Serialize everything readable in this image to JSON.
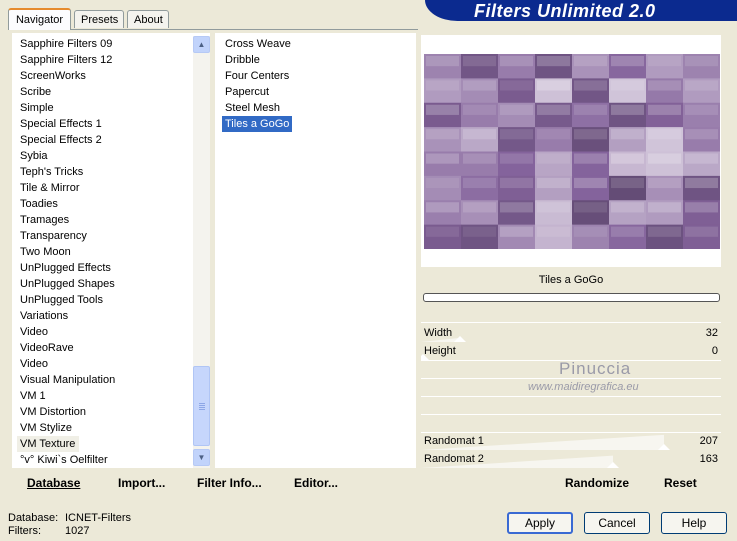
{
  "tabs": [
    {
      "label": "Navigator"
    },
    {
      "label": "Presets"
    },
    {
      "label": "About"
    }
  ],
  "title": "Filters Unlimited 2.0",
  "categories": [
    "Sapphire Filters 09",
    "Sapphire Filters 12",
    "ScreenWorks",
    "Scribe",
    "Simple",
    "Special Effects 1",
    "Special Effects 2",
    "Sybia",
    "Teph's Tricks",
    "Tile & Mirror",
    "Toadies",
    "Tramages",
    "Transparency",
    "Two Moon",
    "UnPlugged Effects",
    "UnPlugged Shapes",
    "UnPlugged Tools",
    "Variations",
    "Video",
    "VideoRave",
    "Video",
    "Visual Manipulation",
    "VM 1",
    "VM Distortion",
    "VM Stylize",
    "VM Texture",
    "°v° Kiwi`s Oelfilter"
  ],
  "filters": [
    "Cross Weave",
    "Dribble",
    "Four Centers",
    "Papercut",
    "Steel Mesh",
    "Tiles a GoGo"
  ],
  "selected_filter": "Tiles a GoGo",
  "highlighted_category": "VM Texture",
  "bottom_buttons": {
    "database": "Database",
    "import": "Import...",
    "filter_info": "Filter Info...",
    "editor": "Editor..."
  },
  "preview": {
    "filter_name": "Tiles a GoGo",
    "base_color": "#7a5a8c"
  },
  "params": [
    {
      "label": "Width",
      "value": "32",
      "level": 0.13
    },
    {
      "label": "Height",
      "value": "0",
      "level": 0.0
    },
    {
      "label": "Randomat 1",
      "value": "207",
      "level": 0.81
    },
    {
      "label": "Randomat 2",
      "value": "163",
      "level": 0.64
    }
  ],
  "watermark": {
    "line1": "Pinuccia",
    "line2": "www.maidiregrafica.eu"
  },
  "actions": {
    "randomize": "Randomize",
    "reset": "Reset"
  },
  "status": {
    "database_label": "Database:",
    "database_value": "ICNET-Filters",
    "filters_label": "Filters:",
    "filters_value": "1027"
  },
  "footer": {
    "apply": "Apply",
    "cancel": "Cancel",
    "help": "Help"
  }
}
